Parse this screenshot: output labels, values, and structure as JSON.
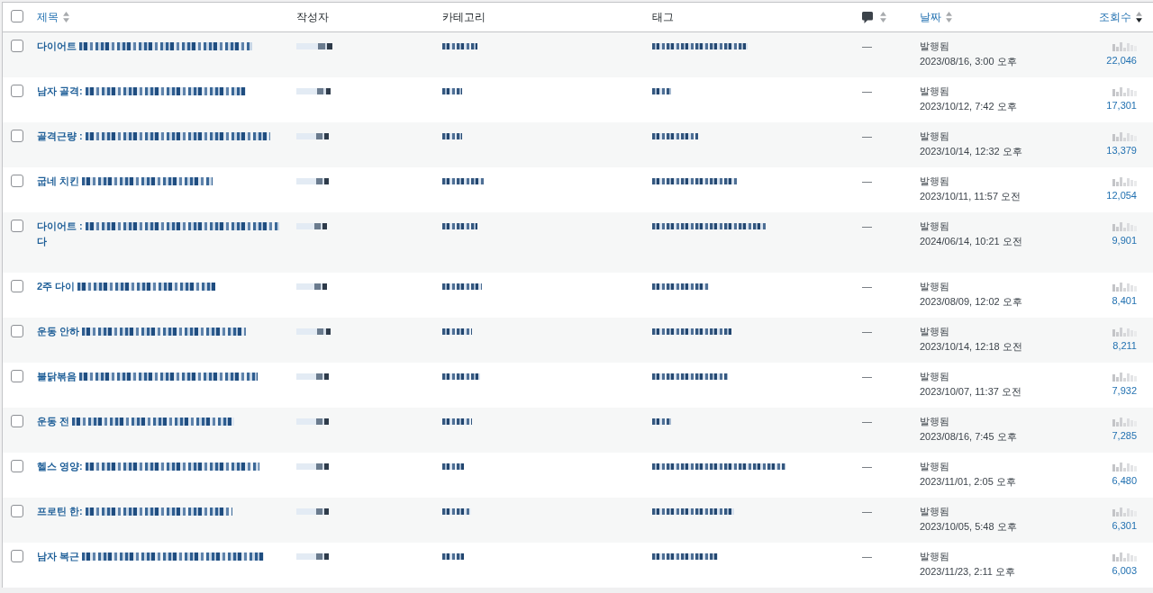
{
  "table": {
    "header": {
      "select_all": {
        "checked": false
      },
      "columns": [
        {
          "kind": "label",
          "label": "제목",
          "sortable": true,
          "sorted": false
        },
        {
          "kind": "label",
          "label": "작성자",
          "sortable": false,
          "sorted": false
        },
        {
          "kind": "label",
          "label": "카테고리",
          "sortable": false,
          "sorted": false
        },
        {
          "kind": "label",
          "label": "태그",
          "sortable": false,
          "sorted": false
        },
        {
          "kind": "icon",
          "sortable": true,
          "sorted": false
        },
        {
          "kind": "label",
          "label": "날짜",
          "sortable": true,
          "sorted": false
        },
        {
          "kind": "label",
          "label": "조회수",
          "sortable": true,
          "sorted": true
        }
      ]
    },
    "rows": [
      {
        "checked": false,
        "title": "다이어트",
        "comments": "—",
        "status": "발행됨",
        "date": "2023/08/16, 3:00 오후",
        "views": "22,046"
      },
      {
        "checked": false,
        "title": "남자 골격:",
        "comments": "—",
        "status": "발행됨",
        "date": "2023/10/12, 7:42 오후",
        "views": "17,301"
      },
      {
        "checked": false,
        "title": "골격근량 :",
        "comments": "—",
        "status": "발행됨",
        "date": "2023/10/14, 12:32 오후",
        "views": "13,379"
      },
      {
        "checked": false,
        "title": "굽네 치킨",
        "comments": "—",
        "status": "발행됨",
        "date": "2023/10/11, 11:57 오전",
        "views": "12,054"
      },
      {
        "checked": false,
        "title": "다이어트 :",
        "title_tail": "다",
        "comments": "—",
        "status": "발행됨",
        "date": "2024/06/14, 10:21 오전",
        "views": "9,901"
      },
      {
        "checked": false,
        "title": "2주 다이",
        "comments": "—",
        "status": "발행됨",
        "date": "2023/08/09, 12:02 오후",
        "views": "8,401"
      },
      {
        "checked": false,
        "title": "운동 안하",
        "comments": "—",
        "status": "발행됨",
        "date": "2023/10/14, 12:18 오전",
        "views": "8,211"
      },
      {
        "checked": false,
        "title": "불닭볶음",
        "comments": "—",
        "status": "발행됨",
        "date": "2023/10/07, 11:37 오전",
        "views": "7,932"
      },
      {
        "checked": false,
        "title": "운동 전",
        "comments": "—",
        "status": "발행됨",
        "date": "2023/08/16, 7:45 오후",
        "views": "7,285"
      },
      {
        "checked": false,
        "title": "헬스 영양:",
        "comments": "—",
        "status": "발행됨",
        "date": "2023/11/01, 2:05 오후",
        "views": "6,480"
      },
      {
        "checked": false,
        "title": "프로틴 한:",
        "comments": "—",
        "status": "발행됨",
        "date": "2023/10/05, 5:48 오후",
        "views": "6,301"
      },
      {
        "checked": false,
        "title": "남자 복근",
        "comments": "—",
        "status": "발행됨",
        "date": "2023/11/23, 2:11 오후",
        "views": "6,003"
      }
    ]
  }
}
